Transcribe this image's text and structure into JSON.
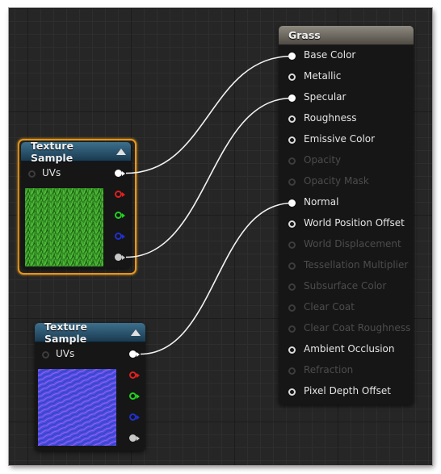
{
  "nodes": {
    "texture_sample_1": {
      "title": "Texture Sample",
      "input_label": "UVs",
      "selected": true,
      "thumbnail": "grass-texture",
      "output_pins": [
        "white",
        "red",
        "green",
        "blue",
        "gray"
      ]
    },
    "texture_sample_2": {
      "title": "Texture Sample",
      "input_label": "UVs",
      "selected": false,
      "thumbnail": "normal-map-texture",
      "output_pins": [
        "white",
        "red",
        "green",
        "blue",
        "gray"
      ]
    },
    "material_result": {
      "title": "Grass",
      "inputs": [
        {
          "label": "Base Color",
          "state": "connected"
        },
        {
          "label": "Metallic",
          "state": "active"
        },
        {
          "label": "Specular",
          "state": "connected"
        },
        {
          "label": "Roughness",
          "state": "active"
        },
        {
          "label": "Emissive Color",
          "state": "active"
        },
        {
          "label": "Opacity",
          "state": "disabled"
        },
        {
          "label": "Opacity Mask",
          "state": "disabled"
        },
        {
          "label": "Normal",
          "state": "connected"
        },
        {
          "label": "World Position Offset",
          "state": "active"
        },
        {
          "label": "World Displacement",
          "state": "disabled"
        },
        {
          "label": "Tessellation Multiplier",
          "state": "disabled"
        },
        {
          "label": "Subsurface Color",
          "state": "disabled"
        },
        {
          "label": "Clear Coat",
          "state": "disabled"
        },
        {
          "label": "Clear Coat Roughness",
          "state": "disabled"
        },
        {
          "label": "Ambient Occlusion",
          "state": "active"
        },
        {
          "label": "Refraction",
          "state": "disabled"
        },
        {
          "label": "Pixel Depth Offset",
          "state": "active"
        }
      ]
    }
  },
  "connections": [
    {
      "from": "texture_sample_1.white",
      "to": "Base Color"
    },
    {
      "from": "texture_sample_1.gray",
      "to": "Specular"
    },
    {
      "from": "texture_sample_2.white",
      "to": "Normal"
    }
  ],
  "pin_colors": {
    "white": "#ffffff",
    "red": "#e02020",
    "green": "#20d020",
    "blue": "#2030d0",
    "gray": "#c8c8c8",
    "wire": "#f2f2f2"
  },
  "colors": {
    "background": "#262626",
    "selection": "#e99a1c",
    "texture_header": "#2c5775",
    "result_header": "#7a756c"
  }
}
